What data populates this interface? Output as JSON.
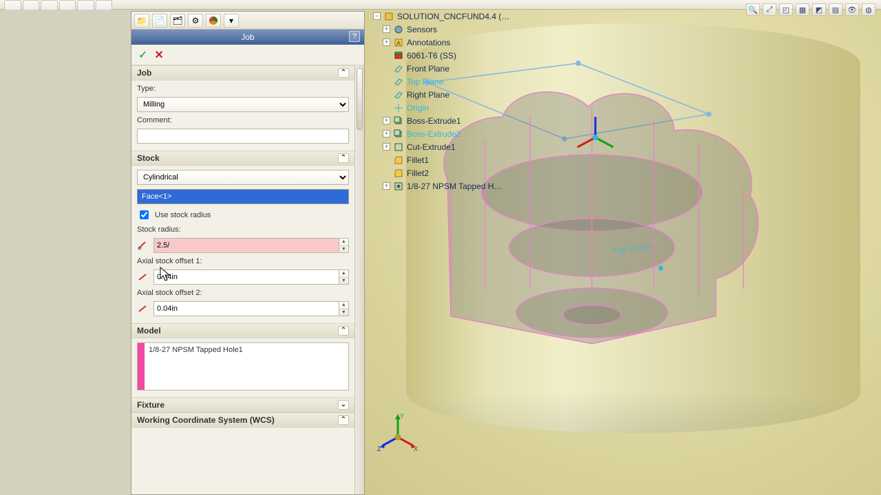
{
  "top_view_icons": [
    "zoom-in-icon",
    "zoom-fit-icon",
    "zoom-area-icon",
    "section-icon",
    "view-orient-icon",
    "display-style-icon",
    "hide-show-icon",
    "appearance-icon",
    "scene-icon",
    "render-icon"
  ],
  "prop_tabs": [
    "feature-manager-icon",
    "property-manager-icon",
    "config-manager-icon",
    "dim-xpert-icon",
    "appearance-pie-icon",
    "filter-icon"
  ],
  "panel": {
    "title": "Job",
    "help": "?",
    "ok_icon": "✓",
    "cancel_icon": "✕",
    "sections": {
      "job": {
        "header": "Job",
        "type_label": "Type:",
        "type_value": "Milling",
        "comment_label": "Comment:",
        "comment_value": ""
      },
      "stock": {
        "header": "Stock",
        "shape_value": "Cylindrical",
        "face_sel": "Face<1>",
        "use_radius_label": "Use stock radius",
        "use_radius_checked": true,
        "radius_label": "Stock radius:",
        "radius_value": "2.5/",
        "ax1_label": "Axial stock offset 1:",
        "ax1_value": "0.04in",
        "ax2_label": "Axial stock offset 2:",
        "ax2_value": "0.04in"
      },
      "model": {
        "header": "Model",
        "items": [
          "1/8-27 NPSM Tapped Hole1"
        ]
      },
      "fixture": {
        "header": "Fixture"
      },
      "wcs": {
        "header": "Working Coordinate System (WCS)"
      }
    }
  },
  "tree": {
    "root": "SOLUTION_CNCFUND4.4  (…",
    "items": [
      {
        "exp": "+",
        "icon": "sensors-icon",
        "label": "Sensors"
      },
      {
        "exp": "+",
        "icon": "annotations-icon",
        "label": "Annotations"
      },
      {
        "exp": "",
        "icon": "material-icon",
        "label": "6061-T6 (SS)"
      },
      {
        "exp": "",
        "icon": "plane-icon",
        "label": "Front Plane"
      },
      {
        "exp": "",
        "icon": "plane-icon",
        "label": "Top Plane",
        "hl": true
      },
      {
        "exp": "",
        "icon": "plane-icon",
        "label": "Right Plane"
      },
      {
        "exp": "",
        "icon": "origin-icon",
        "label": "Origin",
        "hl": true
      },
      {
        "exp": "+",
        "icon": "extrude-icon",
        "label": "Boss-Extrude1"
      },
      {
        "exp": "+",
        "icon": "extrude-icon",
        "label": "Boss-Extrude2",
        "hl": true
      },
      {
        "exp": "+",
        "icon": "cut-icon",
        "label": "Cut-Extrude1"
      },
      {
        "exp": "",
        "icon": "fillet-icon",
        "label": "Fillet1"
      },
      {
        "exp": "",
        "icon": "fillet-icon",
        "label": "Fillet2"
      },
      {
        "exp": "+",
        "icon": "hole-icon",
        "label": "1/8-27 NPSM Tapped H…"
      }
    ]
  },
  "triad": {
    "x": "X",
    "y": "Y",
    "z": "Z"
  },
  "colors": {
    "panel_accent": "#3f5f94",
    "select_blue": "#2f6bd8",
    "error_pink": "#f8c9c9",
    "model_bar": "#ee4aa2",
    "wire_pink": "#e483c7",
    "wire_blue": "#7fb6e6"
  }
}
